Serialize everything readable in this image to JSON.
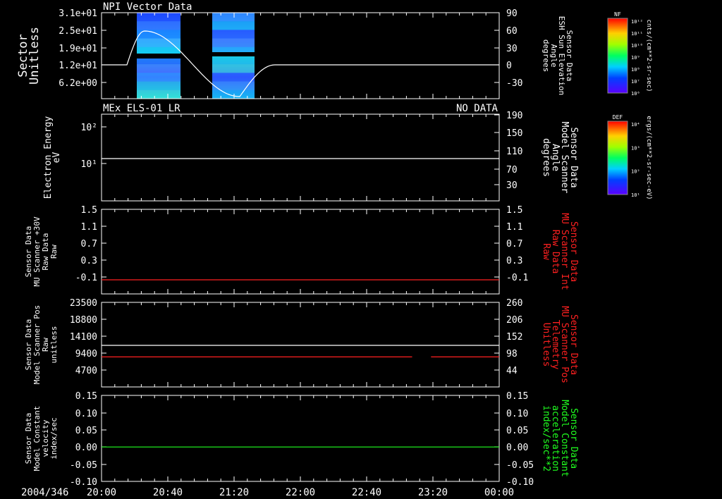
{
  "time_axis": {
    "start_label": "2004/346",
    "ticks": [
      "20:00",
      "20:40",
      "21:20",
      "22:00",
      "22:40",
      "23:20",
      "00:00"
    ]
  },
  "colorbars": [
    {
      "name": "NF",
      "unit": "cnts/(cm**2-sr-sec)",
      "labels": [
        "10¹²",
        "10¹¹",
        "10¹⁰",
        "10⁹",
        "10⁸",
        "10⁷",
        "10⁶"
      ]
    },
    {
      "name": "DEF",
      "unit": "ergs/(cm**2-sr-sec-eV)",
      "labels": [
        "10⁴",
        "10³",
        "10²",
        "10¹"
      ]
    }
  ],
  "chart_data": [
    {
      "type": "heatmap",
      "title": "NPI Vector Data",
      "ylabel": "Sector\nUnitless",
      "yticks": [
        "3.1e+01",
        "2.5e+01",
        "1.9e+01",
        "1.2e+01",
        "6.2e+00"
      ],
      "right_ylabel": "Sensor Data\nESH Sun Elevation\nAngle\ndegrees",
      "right_yticks": [
        "90",
        "60",
        "30",
        "0",
        "-30"
      ],
      "right_ylim": [
        -50,
        90
      ],
      "heat_blocks": [
        {
          "t_start": "20:26",
          "t_end": "20:58"
        },
        {
          "t_start": "21:04",
          "t_end": "21:36"
        }
      ],
      "series": [
        {
          "color": "#ffffff",
          "x_min": [
            0,
            50,
            60,
            100,
            120,
            140,
            160,
            200,
            240,
            270,
            420
          ],
          "values": [
            0,
            0,
            25,
            65,
            60,
            35,
            -5,
            -45,
            -35,
            0,
            0
          ]
        }
      ]
    },
    {
      "type": "line",
      "title": "MEx ELS-01 LR",
      "status": "NO DATA",
      "ylabel": "Electron Energy\neV",
      "yticks": [
        "10²",
        "10¹"
      ],
      "right_ylabel": "Sensor Data\nModel Scanner\nAngle\ndegrees",
      "right_yticks": [
        "190",
        "150",
        "110",
        "70",
        "30"
      ],
      "right_ylim": [
        0,
        190
      ],
      "series": [
        {
          "color": "#ffffff",
          "x_min": [
            0,
            420
          ],
          "values": [
            90,
            90
          ]
        }
      ]
    },
    {
      "type": "line",
      "ylabel": "Sensor Data\nMU Scanner +30V\nRaw Data\nRaw",
      "yticks": [
        "1.5",
        "1.1",
        "0.7",
        "0.3",
        "-0.1"
      ],
      "ylim": [
        -0.3,
        1.5
      ],
      "right_ylabel": "Sensor Data\nMU Scanner Int\nRaw Data\nRaw",
      "right_yticks": [
        "1.5",
        "1.1",
        "0.7",
        "0.3",
        "-0.1"
      ],
      "series": [
        {
          "color": "#ff2020",
          "x_min": [
            0,
            420
          ],
          "values": [
            0,
            0
          ]
        }
      ]
    },
    {
      "type": "line",
      "ylabel": "Sensor Data\nModel Scanner Pos\nRaw\nunitless",
      "yticks": [
        "23500",
        "18800",
        "14100",
        "9400",
        "4700"
      ],
      "ylim": [
        0,
        23500
      ],
      "right_ylabel": "Sensor Data\nMU Scanner Pos\nTelemetry\nUnitless",
      "right_yticks": [
        "260",
        "206",
        "152",
        "98",
        "44"
      ],
      "right_ylim": [
        0,
        260
      ],
      "series": [
        {
          "color": "#ffffff",
          "x_min": [
            0,
            420
          ],
          "values": [
            11700,
            11700
          ]
        },
        {
          "color": "#ff2020",
          "x_min": [
            0,
            328
          ],
          "values": [
            8350,
            8350
          ]
        },
        {
          "color": "#ff2020",
          "x_min": [
            348,
            420
          ],
          "values": [
            8350,
            8350
          ]
        }
      ]
    },
    {
      "type": "line",
      "ylabel": "Sensor Data\nModel Constant\nvelocity\nindex/sec",
      "yticks": [
        "0.15",
        "0.10",
        "0.05",
        "0.00",
        "-0.05",
        "-0.10"
      ],
      "ylim": [
        -0.1,
        0.15
      ],
      "right_ylabel": "Sensor Data\nModel Constant\nacceleration\nindex/sec**2",
      "right_yticks": [
        "0.15",
        "0.10",
        "0.05",
        "0.00",
        "-0.05",
        "-0.10"
      ],
      "series": [
        {
          "color": "#20ff20",
          "x_min": [
            0,
            420
          ],
          "values": [
            0,
            0
          ]
        }
      ]
    }
  ]
}
